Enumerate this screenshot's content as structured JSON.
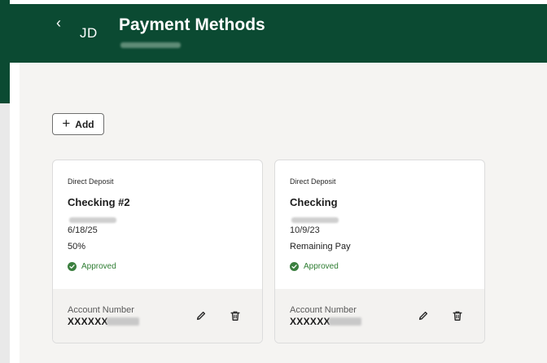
{
  "header": {
    "back_icon": "chevron-left-icon",
    "initials": "JD",
    "title": "Payment Methods"
  },
  "toolbar": {
    "add_label": "Add",
    "add_icon": "plus-icon"
  },
  "cards": [
    {
      "type": "Direct Deposit",
      "name": "Checking #2",
      "date": "6/18/25",
      "amount": "50%",
      "status": "Approved",
      "account_label": "Account Number",
      "account_value": "XXXXXX",
      "edit_icon": "pencil-icon",
      "delete_icon": "trash-icon"
    },
    {
      "type": "Direct Deposit",
      "name": "Checking",
      "date": "10/9/23",
      "amount": "Remaining Pay",
      "status": "Approved",
      "account_label": "Account Number",
      "account_value": "XXXXXX",
      "edit_icon": "pencil-icon",
      "delete_icon": "trash-icon"
    }
  ],
  "colors": {
    "header_bg": "#0b4a32",
    "approved": "#2e7d32",
    "content_bg": "#f5f4f2"
  }
}
